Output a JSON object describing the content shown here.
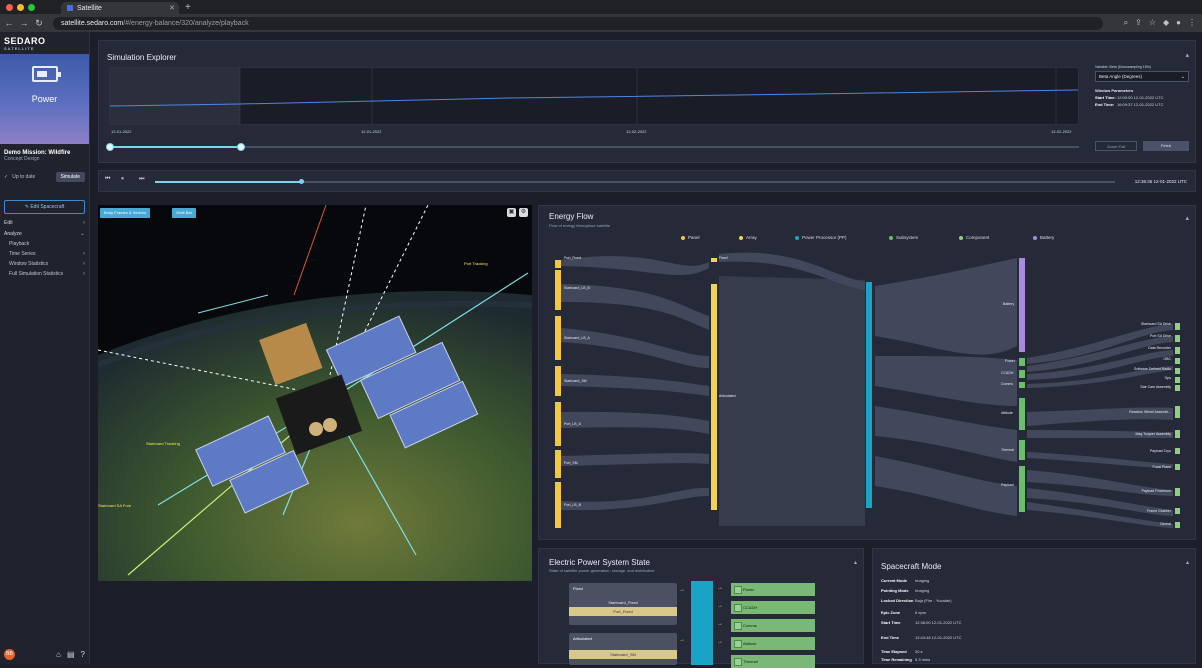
{
  "browser": {
    "tab_title": "Satellite",
    "url_host": "satellite.sedaro.com",
    "url_path": "/#/energy-balance/320/analyze/playback"
  },
  "sidebar": {
    "logo": "SEDARO",
    "logo_sub": "SATELLITE",
    "module": "Power",
    "mission_name": "Demo Mission: Wildfire",
    "mission_sub": "Concept Design",
    "sync_status": "Up to date",
    "simulate": "Simulate",
    "edit_spacecraft": "Edit Spacecraft",
    "menu": [
      {
        "label": "Edit",
        "sub": false
      },
      {
        "label": "Analyze",
        "sub": false
      },
      {
        "label": "Playback",
        "sub": true
      },
      {
        "label": "Time Series",
        "sub": true
      },
      {
        "label": "Window Statistics",
        "sub": true
      },
      {
        "label": "Full Simulation Statistics",
        "sub": true
      }
    ],
    "avatar": "BB"
  },
  "explorer": {
    "title": "Simulation Explorer",
    "ticks": [
      "12-01-2022",
      "12-01-2022",
      "12-02-2022",
      "12-02-2022"
    ],
    "variable_label": "Variable: Beta (Downsampling 15%)",
    "variable_value": "Beta Angle (Degrees)",
    "window_params": "Window Parameters",
    "start_label": "Start Time:",
    "start_value": "12:00:00 12-01-2022 UTC",
    "end_label": "End Time:",
    "end_value": "16:09:37 12-01-2022 UTC",
    "zoom_btn": "Zoom Full",
    "fetch_btn": "Fetch"
  },
  "playback": {
    "time": "12:36:36 12-01-2022 UTC",
    "progress": 0.15
  },
  "viewport": {
    "btn_vectors": "Body Frames & Vectors",
    "btn_orbit": "Orbit Bar",
    "labels": [
      "Port Tracking",
      "Starboard Tracking",
      "Starboard SA Fore"
    ]
  },
  "energy": {
    "title": "Energy Flow",
    "subtitle": "Flow of energy throughout satellite",
    "legend": [
      {
        "label": "Panel",
        "color": "#f2c744"
      },
      {
        "label": "Array",
        "color": "#f0d354"
      },
      {
        "label": "Power Processor (PP)",
        "color": "#19a3c4"
      },
      {
        "label": "Subsystem",
        "color": "#6abf69"
      },
      {
        "label": "Component",
        "color": "#8fcf7d"
      },
      {
        "label": "Battery",
        "color": "#a98ae0"
      }
    ],
    "panels": [
      "Port_Fixed",
      "Starboard_LB_B",
      "Starboard_LB_A",
      "Starboard_SM",
      "Port_LB_A",
      "Port_SM",
      "Port_LB_B"
    ],
    "arrays": [
      "Fixed",
      "Articulated"
    ],
    "subsystems": [
      "Battery",
      "Power",
      "CC&DH",
      "Comms",
      "Attitude",
      "Thermal",
      "Payload"
    ],
    "components": [
      "Starboard SA Drive",
      "Port SA Drive",
      "Data Recorder",
      "OBC",
      "Software Defined Radio",
      "Gps",
      "Star Cam Assembly",
      "Reaction Wheel Assembl...",
      "Mag Torquer Assembly",
      "Payload Cryo",
      "Focal Plane",
      "Payload Processor",
      "Frame Grabber",
      "Gimbal"
    ]
  },
  "eps": {
    "title": "Electric Power System State",
    "subtitle": "State of satellite power generation, storage, and distribution",
    "fixed_hdr": "Fixed",
    "fixed_rows": [
      "Starboard_Fixed",
      "Port_Fixed"
    ],
    "artic_hdr": "Articulated",
    "artic_rows": [
      "Starboard_SM"
    ],
    "subsystems": [
      "Power",
      "CC&DH",
      "Comms",
      "Attitude",
      "Thermal"
    ]
  },
  "mode": {
    "title": "Spacecraft Mode",
    "rows": [
      {
        "k": "Current Mode",
        "v": "Imaging"
      },
      {
        "k": "Pointing Mode",
        "v": "Imaging"
      },
      {
        "k": "Locked Direction",
        "v": "Baja (Fire - Yucatán)"
      },
      {
        "k": "Epic Zone",
        "v": "6 epm"
      },
      {
        "k": "Start Time",
        "v": "12:38:00 12-01-2022 UTC"
      },
      {
        "k": "End Time",
        "v": "12:43:48 12-01-2022 UTC"
      },
      {
        "k": "Time Elapsed",
        "v": "30 s"
      },
      {
        "k": "Time Remaining",
        "v": "5.3 mins"
      }
    ]
  }
}
